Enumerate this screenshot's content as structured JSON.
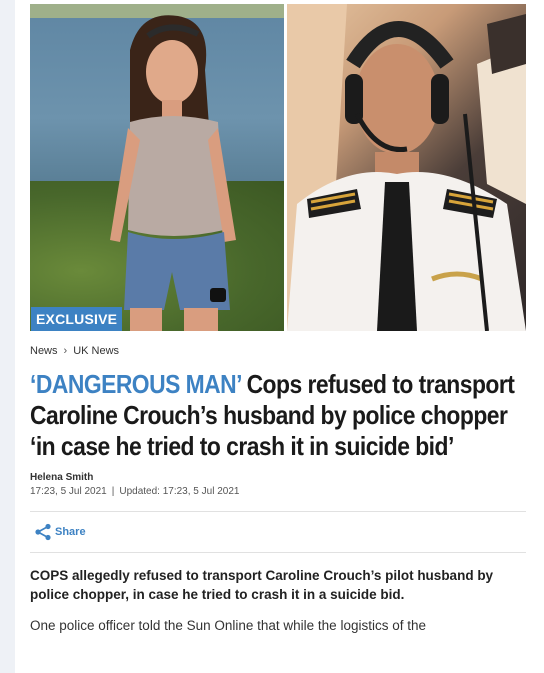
{
  "hero": {
    "badge": "EXCLUSIVE"
  },
  "breadcrumb": {
    "items": [
      "News",
      "UK News"
    ]
  },
  "headline": {
    "kicker": "‘DANGEROUS MAN’",
    "title": "Cops refused to transport Caroline Crouch’s husband by police chopper ‘in case he tried to crash it in suicide bid’"
  },
  "byline": {
    "author": "Helena Smith",
    "published": "17:23, 5 Jul 2021",
    "separator": "|",
    "updated": "Updated: 17:23, 5 Jul 2021"
  },
  "share": {
    "label": "Share"
  },
  "body": {
    "lede": "COPS allegedly refused to transport Caroline Crouch’s pilot husband by police chopper, in case he tried to crash it in a suicide bid.",
    "para1": "One police officer told the Sun Online that while the logistics of the"
  },
  "colors": {
    "accent": "#3d82c3"
  }
}
